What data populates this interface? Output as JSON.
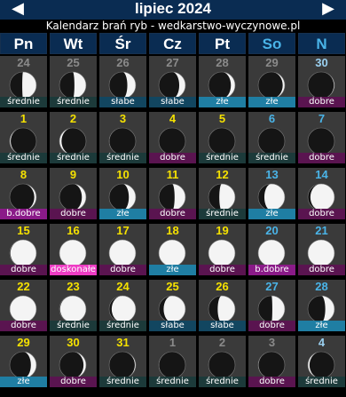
{
  "header": {
    "prev": "◀",
    "next": "▶",
    "title": "lipiec 2024",
    "subtitle": "Kalendarz brań ryb - wedkarstwo-wyczynowe.pl"
  },
  "weekdays": [
    {
      "label": "Pn",
      "weekend": false
    },
    {
      "label": "Wt",
      "weekend": false
    },
    {
      "label": "Śr",
      "weekend": false
    },
    {
      "label": "Cz",
      "weekend": false
    },
    {
      "label": "Pt",
      "weekend": false
    },
    {
      "label": "So",
      "weekend": true
    },
    {
      "label": "N",
      "weekend": true
    }
  ],
  "colors": {
    "other_month_num": "#8a8a8a",
    "num": "#f5e100",
    "num_weekend": "#4ab4e8",
    "num_other_sunday": "#9ad0f0",
    "rating": {
      "średnie": "#1c3a3a",
      "słabe": "#124660",
      "złe": "#1f7ea3",
      "dobre": "#5a1450",
      "b.dobre": "#8a1a88",
      "doskonałe": "#ee3cc4"
    }
  },
  "days": [
    {
      "day": "24",
      "other": true,
      "rating": "średnie",
      "phase": 0.74
    },
    {
      "day": "25",
      "other": true,
      "rating": "średnie",
      "phase": 0.77
    },
    {
      "day": "26",
      "other": true,
      "rating": "słabe",
      "phase": 0.81
    },
    {
      "day": "27",
      "other": true,
      "rating": "słabe",
      "phase": 0.84
    },
    {
      "day": "28",
      "other": true,
      "rating": "złe",
      "phase": 0.87
    },
    {
      "day": "29",
      "other": true,
      "rating": "złe",
      "phase": 0.91
    },
    {
      "day": "30",
      "other": true,
      "rating": "dobre",
      "phase": 0.95
    },
    {
      "day": "1",
      "rating": "średnie",
      "phase": 0.06
    },
    {
      "day": "2",
      "rating": "średnie",
      "phase": 0.09
    },
    {
      "day": "3",
      "rating": "średnie",
      "phase": 0.03
    },
    {
      "day": "4",
      "rating": "dobre",
      "phase": 0.0
    },
    {
      "day": "5",
      "rating": "średnie",
      "phase": 0.0
    },
    {
      "day": "6",
      "rating": "średnie",
      "phase": 0.0
    },
    {
      "day": "7",
      "rating": "dobre",
      "phase": 0.0
    },
    {
      "day": "8",
      "rating": "b.dobre",
      "phase": 0.91
    },
    {
      "day": "9",
      "rating": "dobre",
      "phase": 0.87
    },
    {
      "day": "10",
      "rating": "złe",
      "phase": 0.83
    },
    {
      "day": "11",
      "rating": "dobre",
      "phase": 0.78
    },
    {
      "day": "12",
      "rating": "średnie",
      "phase": 0.72
    },
    {
      "day": "13",
      "rating": "złe",
      "phase": 0.66
    },
    {
      "day": "14",
      "rating": "dobre",
      "phase": 0.6
    },
    {
      "day": "15",
      "rating": "dobre",
      "phase": 0.55
    },
    {
      "day": "16",
      "rating": "doskonałe",
      "phase": 0.5
    },
    {
      "day": "17",
      "rating": "dobre",
      "phase": 0.5
    },
    {
      "day": "18",
      "rating": "złe",
      "phase": 0.5
    },
    {
      "day": "19",
      "rating": "dobre",
      "phase": 0.5
    },
    {
      "day": "20",
      "rating": "b.dobre",
      "phase": 0.5
    },
    {
      "day": "21",
      "rating": "dobre",
      "phase": 0.5
    },
    {
      "day": "22",
      "rating": "dobre",
      "phase": 0.52
    },
    {
      "day": "23",
      "rating": "średnie",
      "phase": 0.55
    },
    {
      "day": "24",
      "rating": "średnie",
      "phase": 0.6
    },
    {
      "day": "25",
      "rating": "słabe",
      "phase": 0.64
    },
    {
      "day": "26",
      "rating": "słabe",
      "phase": 0.7
    },
    {
      "day": "27",
      "rating": "dobre",
      "phase": 0.76
    },
    {
      "day": "28",
      "rating": "złe",
      "phase": 0.8
    },
    {
      "day": "29",
      "rating": "złe",
      "phase": 0.85
    },
    {
      "day": "30",
      "rating": "dobre",
      "phase": 0.9
    },
    {
      "day": "31",
      "rating": "średnie",
      "phase": 0.94
    },
    {
      "day": "1",
      "other": true,
      "rating": "średnie",
      "phase": 0.03
    },
    {
      "day": "2",
      "other": true,
      "rating": "średnie",
      "phase": 0.02
    },
    {
      "day": "3",
      "other": true,
      "rating": "dobre",
      "phase": 0.04
    },
    {
      "day": "4",
      "other": true,
      "rating": "średnie",
      "phase": 0.08
    }
  ]
}
